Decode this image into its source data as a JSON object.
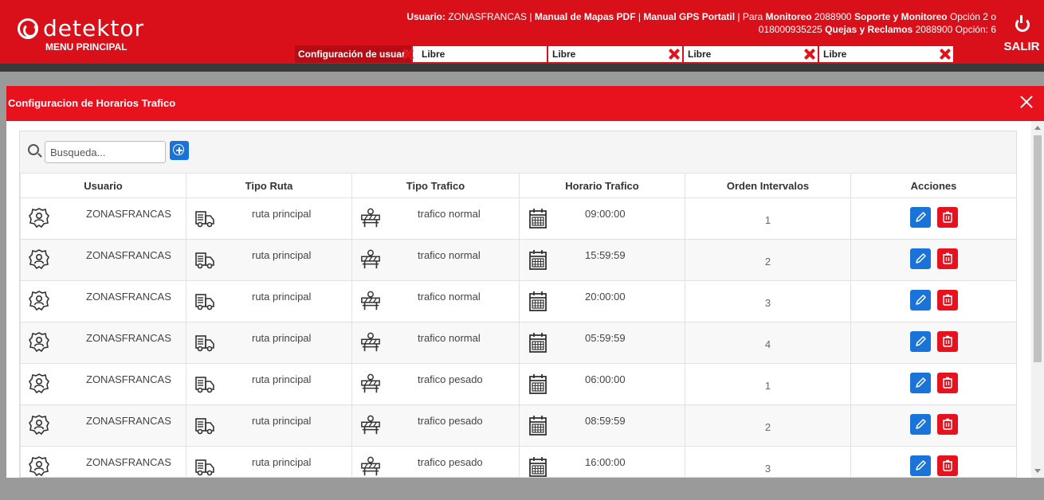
{
  "header": {
    "logo_text": "detektor",
    "menu_label": "MENU PRINCIPAL",
    "info_line1_parts": [
      "Usuario:",
      "ZONASFRANCAS |",
      "Manual de Mapas PDF",
      "|",
      "Manual GPS Portatil",
      "| Para",
      "Monitoreo",
      "2088900",
      "Soporte y Monitoreo",
      "Opción 2 o"
    ],
    "info_line2_parts": [
      "018000935225",
      "Quejas y Reclamos",
      "2088900 Opción: 6"
    ],
    "salir_label": "SALIR",
    "tab_config": "Configuración de usuari",
    "slots": [
      "Libre",
      "Libre",
      "Libre",
      "Libre"
    ]
  },
  "modal": {
    "title": "Configuracion de Horarios Trafico",
    "search_placeholder": "Busqueda...",
    "columns": [
      "Usuario",
      "Tipo Ruta",
      "Tipo Trafico",
      "Horario Trafico",
      "Orden Intervalos",
      "Acciones"
    ],
    "rows": [
      {
        "usuario": "ZONASFRANCAS",
        "ruta": "ruta principal",
        "trafico": "trafico normal",
        "horario": "09:00:00",
        "orden": "1"
      },
      {
        "usuario": "ZONASFRANCAS",
        "ruta": "ruta principal",
        "trafico": "trafico normal",
        "horario": "15:59:59",
        "orden": "2"
      },
      {
        "usuario": "ZONASFRANCAS",
        "ruta": "ruta principal",
        "trafico": "trafico normal",
        "horario": "20:00:00",
        "orden": "3"
      },
      {
        "usuario": "ZONASFRANCAS",
        "ruta": "ruta principal",
        "trafico": "trafico normal",
        "horario": "05:59:59",
        "orden": "4"
      },
      {
        "usuario": "ZONASFRANCAS",
        "ruta": "ruta principal",
        "trafico": "trafico pesado",
        "horario": "06:00:00",
        "orden": "1"
      },
      {
        "usuario": "ZONASFRANCAS",
        "ruta": "ruta principal",
        "trafico": "trafico pesado",
        "horario": "08:59:59",
        "orden": "2"
      },
      {
        "usuario": "ZONASFRANCAS",
        "ruta": "ruta principal",
        "trafico": "trafico pesado",
        "horario": "16:00:00",
        "orden": "3"
      }
    ]
  },
  "colors": {
    "brand_red": "#d9101a",
    "modal_red": "#e8121e",
    "edit_blue": "#1a73d9"
  },
  "icons": {
    "user": "user-gear-icon",
    "ruta": "truck-icon",
    "trafico": "traffic-barrier-icon",
    "horario": "calendar-icon",
    "edit": "pencil-icon",
    "delete": "trash-icon",
    "add": "plus-circle-icon",
    "close": "close-icon",
    "power": "power-icon"
  }
}
